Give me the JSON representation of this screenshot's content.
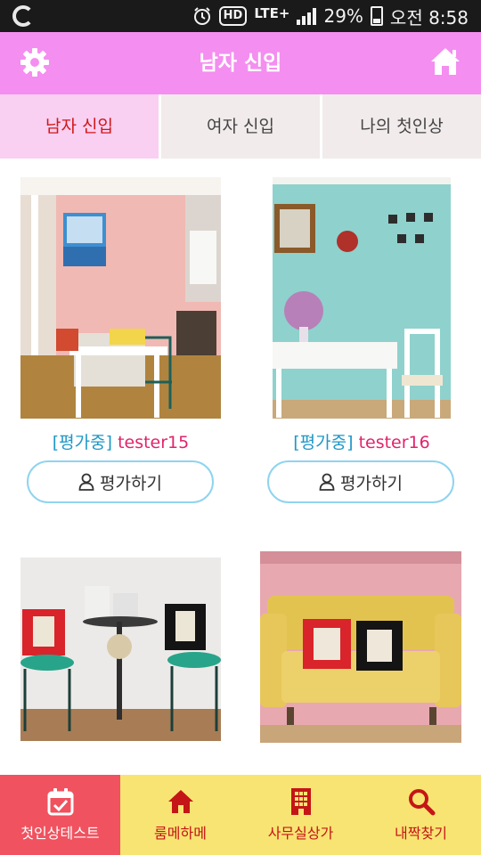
{
  "status_bar": {
    "hd_label": "HD",
    "network": "LTE+",
    "battery": "29%",
    "time": "오전 8:58"
  },
  "header": {
    "title": "남자 신입",
    "settings_icon": "gear-icon",
    "home_icon": "home-icon",
    "color": "#f48ef0"
  },
  "tabs": [
    {
      "label": "남자 신입",
      "active": true
    },
    {
      "label": "여자 신입",
      "active": false
    },
    {
      "label": "나의 첫인상",
      "active": false
    }
  ],
  "cards": [
    {
      "status": "[평가중]",
      "user": "tester15",
      "button": "평가하기",
      "photo": "pink room with white table and chairs"
    },
    {
      "status": "[평가중]",
      "user": "tester16",
      "button": "평가하기",
      "photo": "mint dining room"
    },
    {
      "status": "",
      "user": "",
      "button": "",
      "photo": "chairs with zebra cushions"
    },
    {
      "status": "",
      "user": "",
      "button": "",
      "photo": "yellow sofa with cushions"
    }
  ],
  "bottom_nav": [
    {
      "label": "첫인상테스트",
      "icon": "calendar-check-icon",
      "active": true
    },
    {
      "label": "룸메하메",
      "icon": "home-icon",
      "active": false
    },
    {
      "label": "사무실상가",
      "icon": "building-icon",
      "active": false
    },
    {
      "label": "내짝찾기",
      "icon": "search-icon",
      "active": false
    }
  ],
  "colors": {
    "accent_pink": "#f48ef0",
    "tab_active_bg": "#f9cff2",
    "tab_active_text": "#d11616",
    "status_blue": "#1f97c6",
    "user_pink": "#e2236c",
    "nav_bg": "#f8e473",
    "nav_active": "#f0525f",
    "nav_text": "#c41616"
  }
}
